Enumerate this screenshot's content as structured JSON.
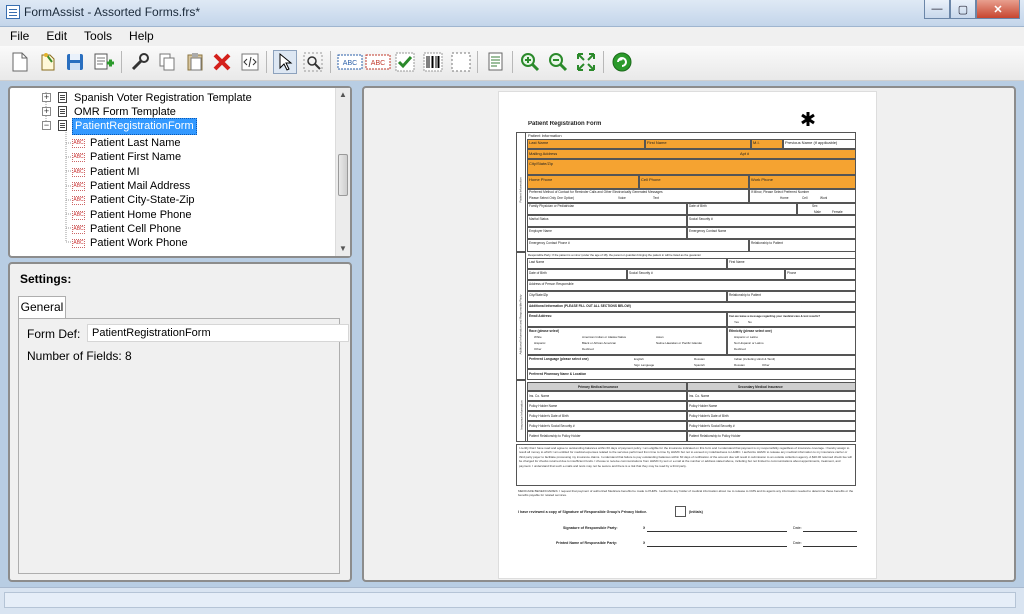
{
  "window": {
    "title": "FormAssist - Assorted Forms.frs*"
  },
  "menu": {
    "items": [
      "File",
      "Edit",
      "Tools",
      "Help"
    ]
  },
  "toolbar": {
    "buttons": [
      "new-document",
      "open",
      "save",
      "add-form",
      "properties",
      "copy",
      "paste",
      "delete",
      "code",
      "select-pointer",
      "zoom-select",
      "text-field",
      "text-field-alt",
      "checkbox-field",
      "barcode-field",
      "region-field",
      "document-view",
      "zoom-in",
      "zoom-out",
      "fit-page",
      "run"
    ],
    "text_button_label": "ABC"
  },
  "tree": {
    "items": [
      {
        "label": "Spanish Voter Registration Template",
        "type": "form",
        "expanded": false
      },
      {
        "label": "OMR Form Template",
        "type": "form",
        "expanded": false
      },
      {
        "label": "PatientRegistrationForm",
        "type": "form",
        "expanded": true,
        "selected": true
      },
      {
        "label": "Patient Last Name",
        "type": "field"
      },
      {
        "label": "Patient First Name",
        "type": "field"
      },
      {
        "label": "Patient MI",
        "type": "field"
      },
      {
        "label": "Patient Mail Address",
        "type": "field"
      },
      {
        "label": "Patient City-State-Zip",
        "type": "field"
      },
      {
        "label": "Patient Home Phone",
        "type": "field"
      },
      {
        "label": "Patient Cell Phone",
        "type": "field"
      },
      {
        "label": "Patient Work Phone",
        "type": "field"
      }
    ],
    "field_icon_text": "ABC"
  },
  "settings": {
    "title": "Settings:",
    "tab_label": "General",
    "form_def_label": "Form Def:",
    "form_def_value": "PatientRegistrationForm",
    "field_count_text": "Number of Fields: 8"
  },
  "form_page": {
    "title": "Patient Registration Form",
    "section_patient": "Patient Information",
    "section_additional": "Additional Information and Responsible Party",
    "section_insurance": "Insurance Information",
    "rows": [
      "Patient Information",
      "Last Name",
      "First Name",
      "M.I.",
      "Previous Name (if applicable)",
      "Mailing Address",
      "Apt #",
      "City/State/Zip",
      "Home Phone",
      "Cell Phone",
      "Work Phone",
      "Preferred Method of Contact for Reminder Calls and Other Electronically Generated Messages",
      "If Minor, Please Select Preferred Number",
      "Please Select Only One Option)",
      "Voice",
      "Text",
      "Home",
      "Cell",
      "Work",
      "Family Physician or Pediatrician",
      "Date of Birth",
      "Sex",
      "Male",
      "Female",
      "Marital Status",
      "Social Security #",
      "Employer Name",
      "Emergency Contact Name",
      "Emergency Contact Phone #",
      "Relationship to Patient",
      "Responsible Party: If the patient is a minor (under the age of 18), the parent or guardian bringing the patient in will be listed as the guarantor",
      "Last Name",
      "First Name",
      "Date of Birth",
      "Social Security #",
      "Phone",
      "Address of Person Responsible",
      "City/State/Zip",
      "Relationship to Patient",
      "Additional Information (PLEASE FILL OUT ALL SECTIONS BELOW)",
      "Email Address:",
      "Can we leave a message regarding your medical care & test results?",
      "Yes",
      "No",
      "Race (please select)",
      "Ethnicity (please select one)",
      "White",
      "American Indian or Alaska Native",
      "Asian",
      "Hispanic or Latino",
      "Hispanic",
      "Black or African American",
      "Native Hawaiian or Pacific Islander",
      "Not Hispanic or Latino",
      "Other",
      "Declined",
      "Declined",
      "Preferred Language (please select one)",
      "English",
      "Russian",
      "Indian (including Hindi & Tamil)",
      "Sign Language",
      "Spanish",
      "Russian",
      "Other",
      "Preferred Pharmacy Name & Location",
      "Primary Medical Insurance",
      "Secondary Medical Insurance",
      "Ins. Co. Name",
      "Ins. Co. Name",
      "Policy Holder Name",
      "Policy Holder Name",
      "Policy Holder's Date of Birth",
      "Policy Holder's Date of Birth",
      "Policy Holder's Social Security #",
      "Policy Holder's Social Security #",
      "Patient Relationship to Policy Holder",
      "Patient Relationship to Policy Holder"
    ],
    "consent_text": "I certify that I have read and agree to outstanding balances within 60 days of payment policy. I am eligible for the insurance indicated on this form and I understand that payment is my responsibility regardless of insurance coverage. I hereby assign to result all money to which I am entitled for medical expenses related to the services performed from time to time by HHMC but not to exceed my indebtedness to HHMC. I authorize HHMC to release any medical information to my insurance carrier or third party payer to facilitate processing my insurance claims. I understand that failure to pay outstanding balances within 60 days of notification of the amount due will result in submission to an outside collection agency. A $20.00 returned check fee will be charged for checks returned due to insufficient funds. I choose to receive communications from HHMC by text or e-mail at the number or address stated above, including but not limited to communications about appointments, treatment, and payment. I understand that such e-mails and texts may not be secure and there is a risk that they may be read by a third party.",
    "medicare_text": "MEDICARE BENEFICIARIES: I request that payment of authorized Medicare benefits be made to PHMS. I authorize any holder of medical information about me to release to CMS and its agents any information needed to determine these benefits or the benefits payable for related services.",
    "privacy_line": "I have reviewed a copy of Signature of Responsible Group's Privacy Notice.",
    "initials": "(Initials)",
    "sig_label": "Signature of Responsible Party:",
    "print_label": "Printed Name of Responsible Party:",
    "x_mark": "X",
    "date_label": "Date:"
  },
  "colors": {
    "highlight": "#f5a331",
    "selection": "#3399ff",
    "toolbar_bg": "#efefef"
  }
}
